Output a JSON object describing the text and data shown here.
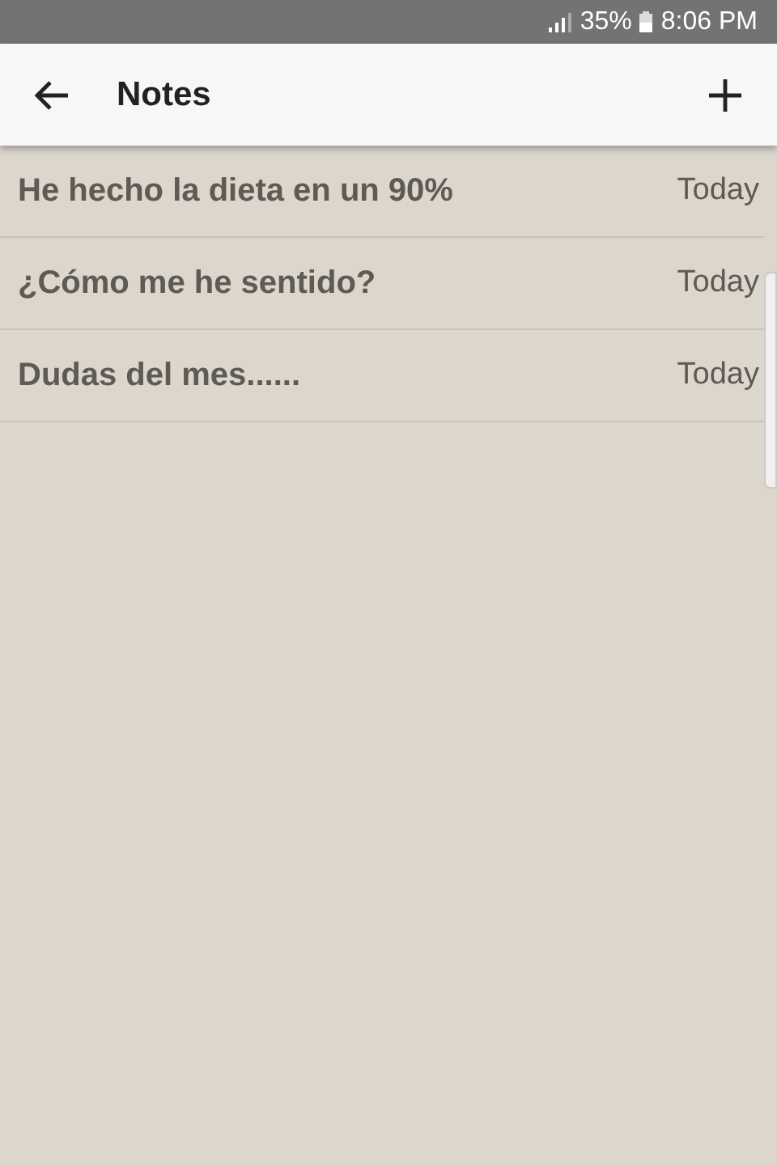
{
  "status_bar": {
    "battery": "35%",
    "time": "8:06 PM"
  },
  "app_bar": {
    "title": "Notes"
  },
  "notes": [
    {
      "title": "He hecho la dieta en un 90%",
      "date": "Today"
    },
    {
      "title": "¿Cómo me he sentido?",
      "date": "Today"
    },
    {
      "title": "Dudas del mes......",
      "date": "Today"
    }
  ]
}
